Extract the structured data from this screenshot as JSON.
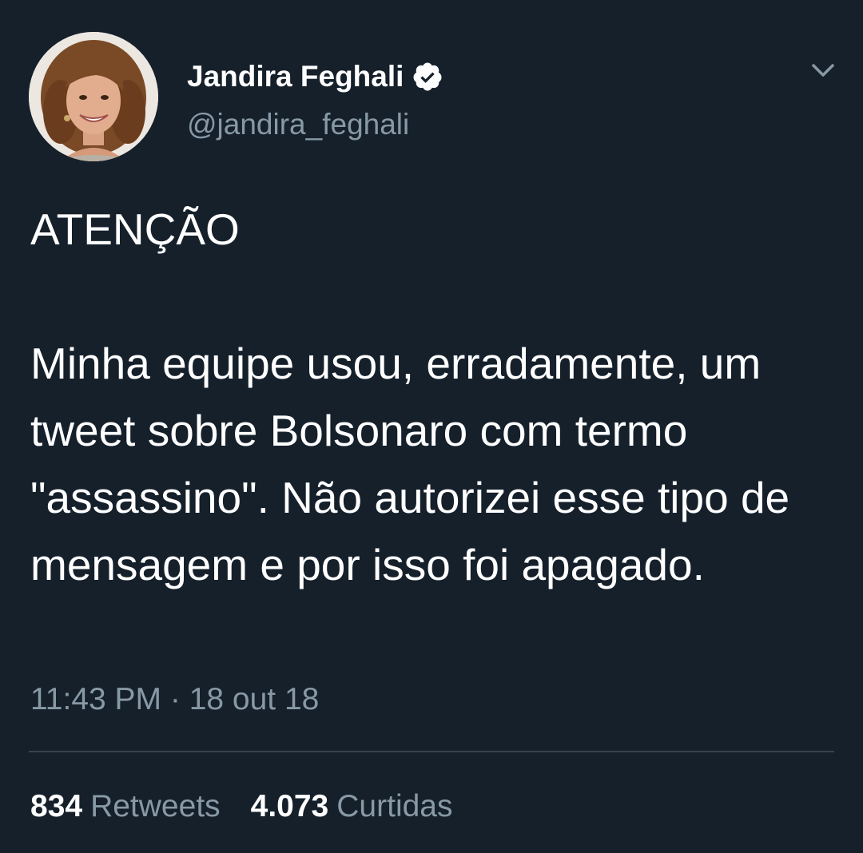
{
  "author": {
    "display_name": "Jandira Feghali",
    "handle": "@jandira_feghali",
    "verified_icon": "verified-badge-icon",
    "menu_icon": "chevron-down-icon"
  },
  "tweet": {
    "text": "ATENÇÃO\n\nMinha equipe usou, erradamente, um tweet sobre Bolsonaro com termo \"assassino\". Não autorizei esse tipo de mensagem e por isso foi apagado.",
    "timestamp": "11:43 PM · 18 out 18"
  },
  "stats": {
    "retweets_count": "834",
    "retweets_label": "Retweets",
    "likes_count": "4.073",
    "likes_label": "Curtidas"
  },
  "colors": {
    "background": "#15202b",
    "primary_text": "#ffffff",
    "secondary_text": "#8899a6",
    "divider": "#38444d"
  }
}
